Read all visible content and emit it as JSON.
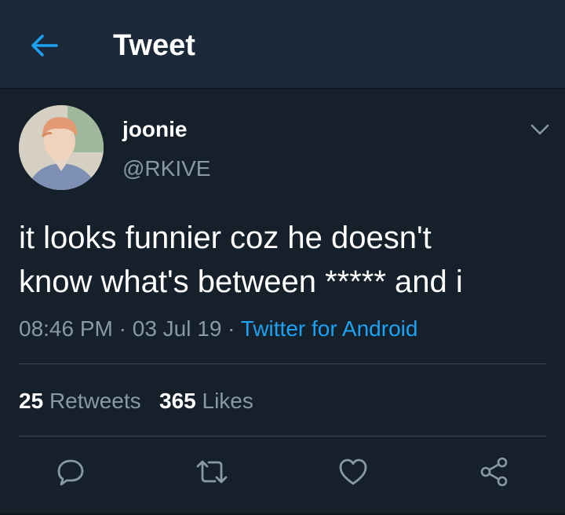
{
  "header": {
    "title": "Tweet",
    "back_icon": "back-arrow-icon"
  },
  "tweet": {
    "display_name": "joonie",
    "handle": "@RKIVE",
    "text": "it looks funnier coz he doesn't\nknow what's between ***** and i",
    "time": "08:46 PM",
    "date": "03 Jul 19",
    "separator": "·",
    "source": "Twitter for Android",
    "retweets_count": "25",
    "retweets_label": "Retweets",
    "likes_count": "365",
    "likes_label": "Likes"
  },
  "actions": [
    "reply-icon",
    "retweet-icon",
    "like-icon",
    "share-icon"
  ],
  "colors": {
    "background": "#15202b",
    "header": "#1c2938",
    "accent": "#1da1f2",
    "muted": "#8899a6"
  }
}
